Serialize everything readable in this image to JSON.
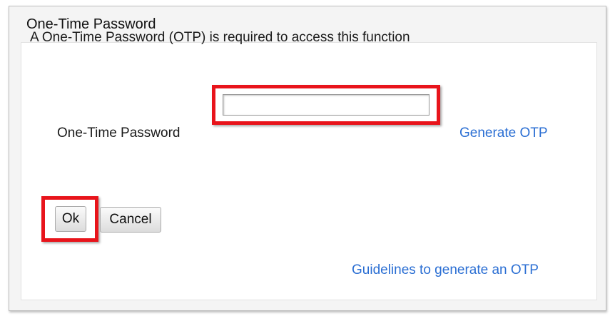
{
  "dialog": {
    "title": "One-Time Password",
    "message": "A One-Time Password (OTP) is required to access this function",
    "otp_field": {
      "label": "One-Time Password",
      "value": "",
      "placeholder": ""
    },
    "generate_link": "Generate OTP",
    "ok_label": "Ok",
    "cancel_label": "Cancel",
    "guidelines_link": "Guidelines to generate an OTP",
    "highlight_color": "#e8141b",
    "link_color": "#2a6ed3"
  }
}
